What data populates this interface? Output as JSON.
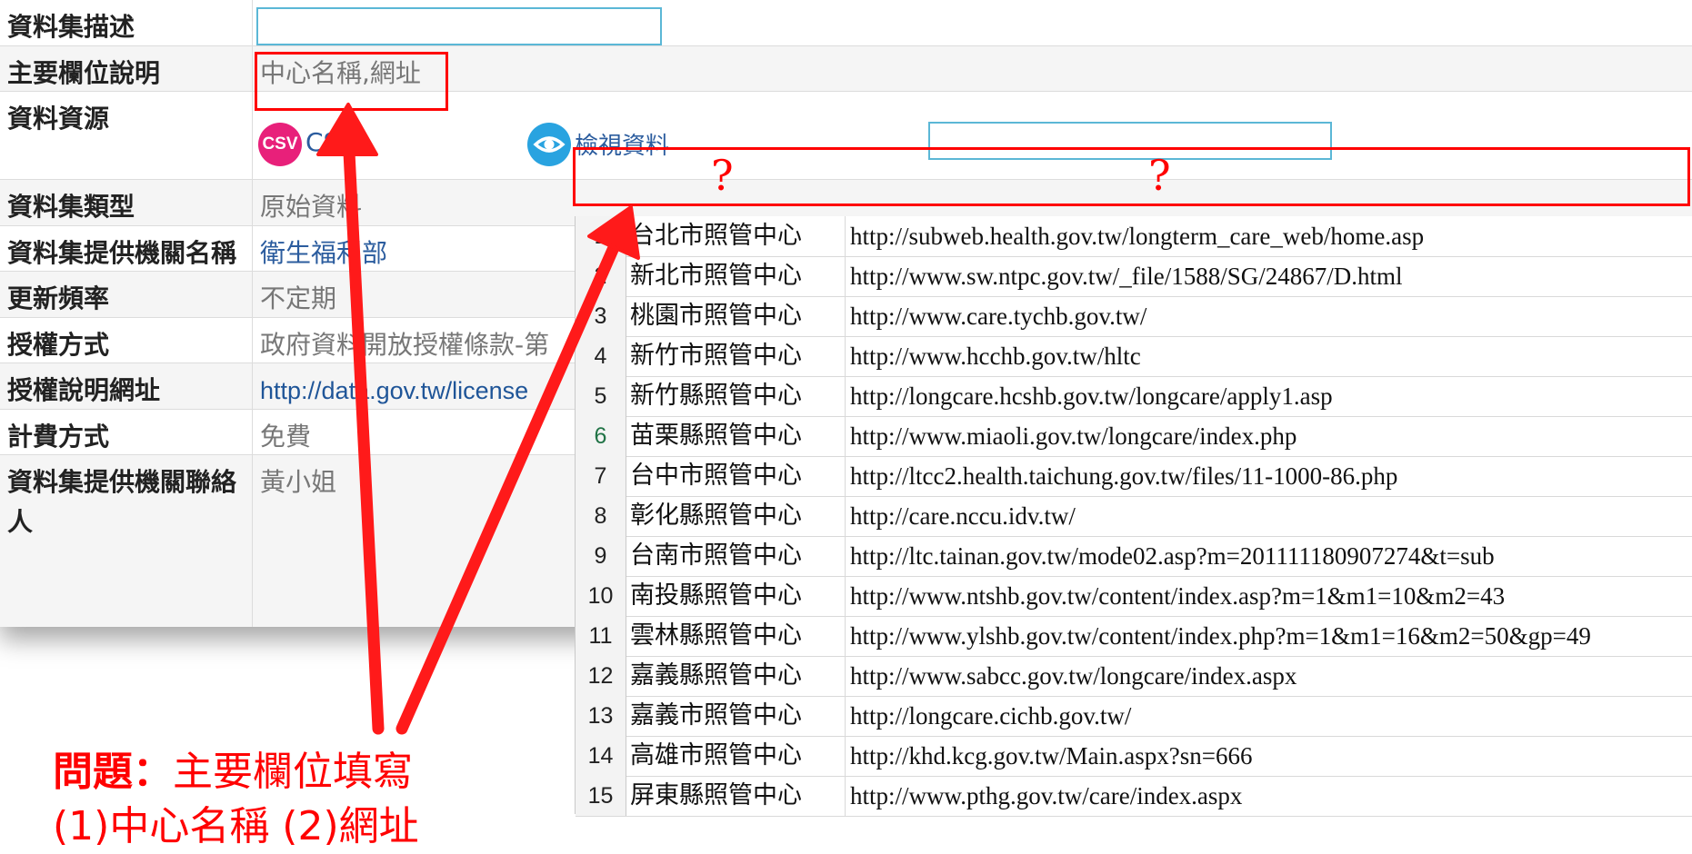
{
  "metadata": {
    "rows": [
      {
        "label": "資料集描述",
        "value": ""
      },
      {
        "label": "主要欄位說明",
        "value": "中心名稱,網址"
      },
      {
        "label": "資料資源",
        "value": ""
      },
      {
        "label": "資料集類型",
        "value": "原始資料"
      },
      {
        "label": "資料集提供機關名稱",
        "value": "衛生福利部"
      },
      {
        "label": "更新頻率",
        "value": "不定期"
      },
      {
        "label": "授權方式",
        "value": "政府資料開放授權條款-第"
      },
      {
        "label": "授權說明網址",
        "value": "http://data.gov.tw/license"
      },
      {
        "label": "計費方式",
        "value": "免費"
      },
      {
        "label": "資料集提供機關聯絡人",
        "value": "黃小姐"
      }
    ],
    "resource": {
      "csv_badge": "CSV",
      "csv_text": "CS",
      "view_text": "檢視資料"
    }
  },
  "question_marks": [
    "?",
    "?"
  ],
  "sheet": {
    "rows": [
      {
        "num": "1",
        "name": "台北市照管中心",
        "url": "http://subweb.health.gov.tw/longterm_care_web/home.asp"
      },
      {
        "num": "2",
        "name": "新北市照管中心",
        "url": "http://www.sw.ntpc.gov.tw/_file/1588/SG/24867/D.html"
      },
      {
        "num": "3",
        "name": "桃園市照管中心",
        "url": "http://www.care.tychb.gov.tw/"
      },
      {
        "num": "4",
        "name": "新竹市照管中心",
        "url": "http://www.hcchb.gov.tw/hltc"
      },
      {
        "num": "5",
        "name": "新竹縣照管中心",
        "url": "http://longcare.hcshb.gov.tw/longcare/apply1.asp"
      },
      {
        "num": "6",
        "name": "苗栗縣照管中心",
        "url": "http://www.miaoli.gov.tw/longcare/index.php"
      },
      {
        "num": "7",
        "name": "台中市照管中心",
        "url": "http://ltcc2.health.taichung.gov.tw/files/11-1000-86.php"
      },
      {
        "num": "8",
        "name": "彰化縣照管中心",
        "url": "http://care.nccu.idv.tw/"
      },
      {
        "num": "9",
        "name": "台南市照管中心",
        "url": "http://ltc.tainan.gov.tw/mode02.asp?m=201111180907274&t=sub"
      },
      {
        "num": "10",
        "name": "南投縣照管中心",
        "url": "http://www.ntshb.gov.tw/content/index.asp?m=1&m1=10&m2=43"
      },
      {
        "num": "11",
        "name": "雲林縣照管中心",
        "url": "http://www.ylshb.gov.tw/content/index.php?m=1&m1=16&m2=50&gp=49"
      },
      {
        "num": "12",
        "name": "嘉義縣照管中心",
        "url": "http://www.sabcc.gov.tw/longcare/index.aspx"
      },
      {
        "num": "13",
        "name": "嘉義市照管中心",
        "url": "http://longcare.cichb.gov.tw/"
      },
      {
        "num": "14",
        "name": "高雄市照管中心",
        "url": "http://khd.kcg.gov.tw/Main.aspx?sn=666"
      },
      {
        "num": "15",
        "name": "屏東縣照管中心",
        "url": "http://www.pthg.gov.tw/care/index.aspx"
      }
    ]
  },
  "annotation": {
    "prefix": "問題：",
    "line1": "主要欄位填寫",
    "line2": "(1)中心名稱 (2)網址"
  },
  "colors": {
    "annotation_red": "#ff0000",
    "input_border": "#5bb7d6",
    "link_blue": "#2b5c9e",
    "csv_badge": "#e8207a",
    "eye_button": "#29a3e0"
  }
}
